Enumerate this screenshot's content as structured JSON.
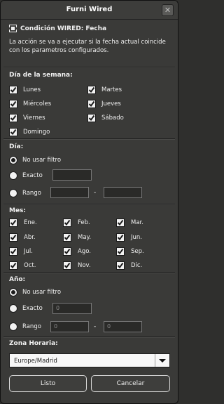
{
  "window": {
    "title": "Furni Wired",
    "close_glyph": "✕"
  },
  "header": {
    "title": "Condición WIRED: Fecha",
    "icon": "wired-condition-icon",
    "description": "La acción se va a ejecutar si la fecha actual coincide con los parametros configurados."
  },
  "weekdays": {
    "label": "Día de la semana:",
    "items": [
      {
        "label": "Lunes",
        "checked": true
      },
      {
        "label": "Martes",
        "checked": true
      },
      {
        "label": "Miércoles",
        "checked": true
      },
      {
        "label": "Jueves",
        "checked": true
      },
      {
        "label": "Viernes",
        "checked": true
      },
      {
        "label": "Sábado",
        "checked": true
      },
      {
        "label": "Domingo",
        "checked": true
      }
    ]
  },
  "day": {
    "label": "Día:",
    "options": {
      "none": "No usar filtro",
      "exact": "Exacto",
      "range": "Rango"
    },
    "selected": "none",
    "exact_value": "",
    "range_from": "",
    "range_to": "",
    "range_sep": "-"
  },
  "months": {
    "label": "Mes:",
    "items": [
      {
        "label": "Ene.",
        "checked": true
      },
      {
        "label": "Feb.",
        "checked": true
      },
      {
        "label": "Mar.",
        "checked": true
      },
      {
        "label": "Abr.",
        "checked": true
      },
      {
        "label": "May.",
        "checked": true
      },
      {
        "label": "Jun.",
        "checked": true
      },
      {
        "label": "Jul.",
        "checked": true
      },
      {
        "label": "Ago.",
        "checked": true
      },
      {
        "label": "Sep.",
        "checked": true
      },
      {
        "label": "Oct.",
        "checked": true
      },
      {
        "label": "Nov.",
        "checked": true
      },
      {
        "label": "Dic.",
        "checked": true
      }
    ]
  },
  "year": {
    "label": "Año:",
    "options": {
      "none": "No usar filtro",
      "exact": "Exacto",
      "range": "Rango"
    },
    "selected": "none",
    "exact_placeholder": "0",
    "range_from_placeholder": "0",
    "range_to_placeholder": "0",
    "range_sep": "-"
  },
  "timezone": {
    "label": "Zona Horaria:",
    "selected": "Europe/Madrid"
  },
  "actions": {
    "ok_label": "Listo",
    "cancel_label": "Cancelar"
  }
}
